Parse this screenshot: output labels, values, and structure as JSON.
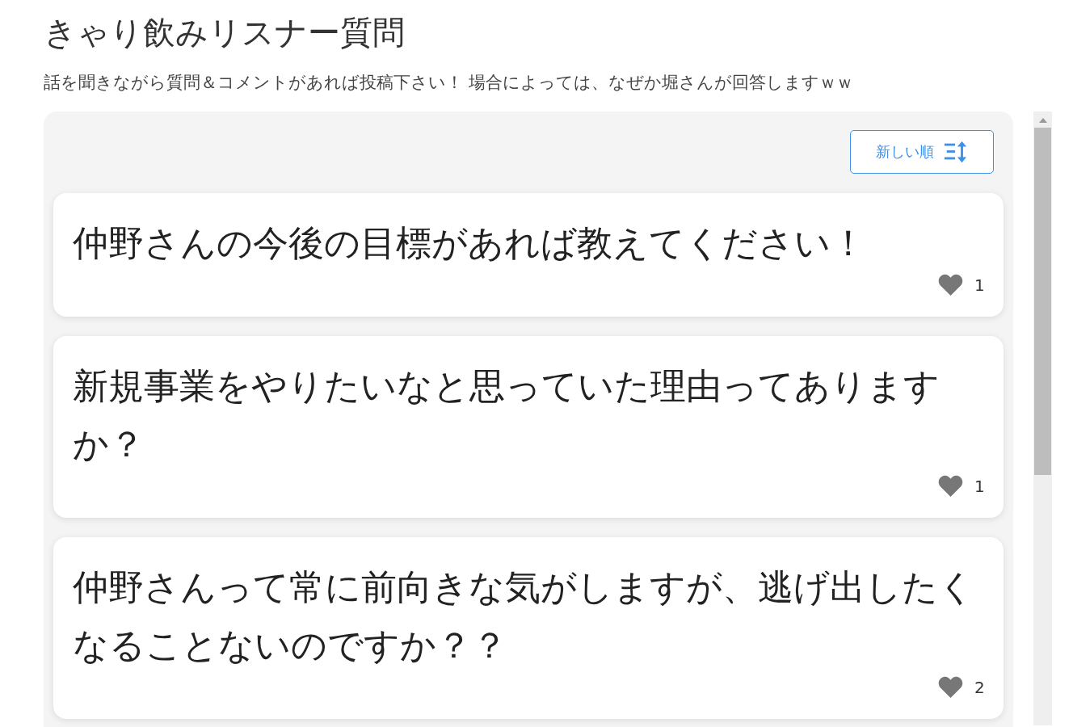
{
  "title": "きゃり飲みリスナー質問",
  "description": "話を聞きながら質問＆コメントがあれば投稿下さい！ 場合によっては、なぜか堀さんが回答しますｗｗ",
  "sort_button": {
    "label": "新しい順"
  },
  "questions": [
    {
      "text": "仲野さんの今後の目標があれば教えてください！",
      "likes": "1"
    },
    {
      "text": "新規事業をやりたいなと思っていた理由ってありますか？",
      "likes": "1"
    },
    {
      "text": "仲野さんって常に前向きな気がしますが、逃げ出したくなることないのですか？？",
      "likes": "2"
    }
  ]
}
